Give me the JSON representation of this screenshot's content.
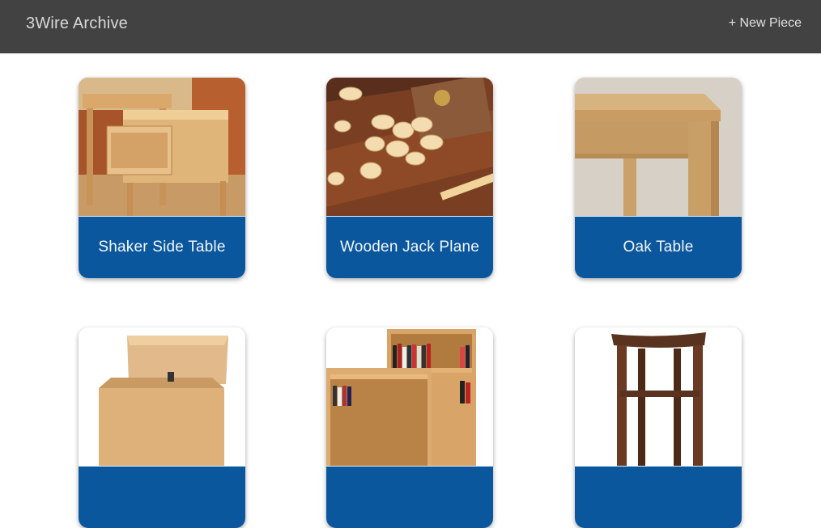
{
  "header": {
    "title": "3Wire Archive",
    "new_piece_label": "+ New Piece"
  },
  "pieces": [
    {
      "title": "Shaker Side Table",
      "image_icon": "shaker-side-table-photo"
    },
    {
      "title": "Wooden Jack Plane",
      "image_icon": "jack-plane-shavings-photo"
    },
    {
      "title": "Oak Table",
      "image_icon": "oak-table-photo"
    },
    {
      "title": "",
      "image_icon": "blanket-chest-photo"
    },
    {
      "title": "",
      "image_icon": "bookcase-photo"
    },
    {
      "title": "",
      "image_icon": "bar-stool-photo"
    }
  ],
  "colors": {
    "header_bg": "#424242",
    "caption_bg": "#0a579e",
    "caption_text": "#f3f6fa"
  }
}
